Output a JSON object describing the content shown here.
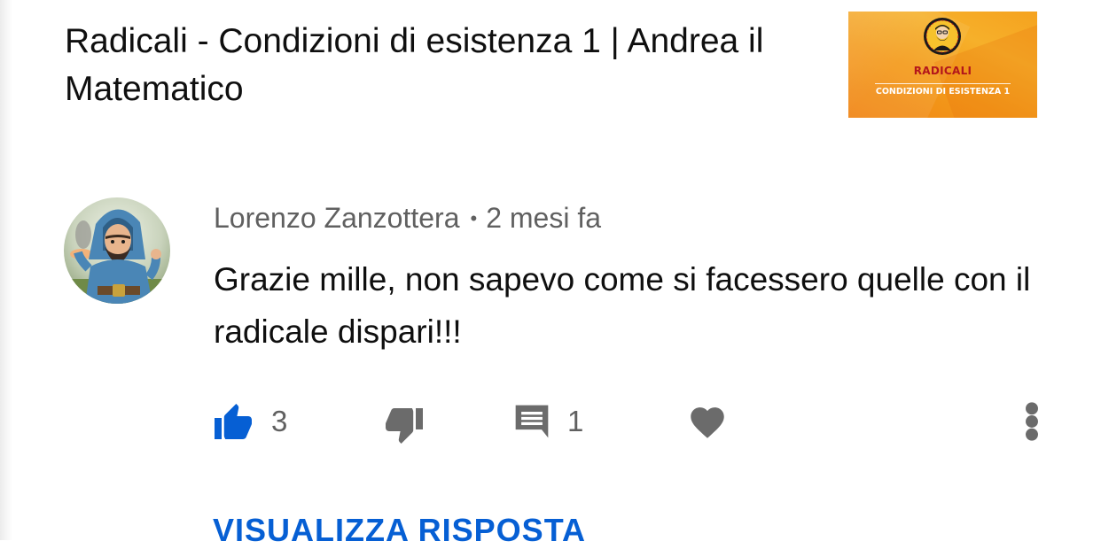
{
  "video": {
    "title": "Radicali - Condizioni di esistenza 1 | Andrea il Matematico",
    "thumbnail": {
      "title": "RADICALI",
      "subtitle": "CONDIZIONI DI ESISTENZA 1",
      "background_color": "#f39a1a",
      "title_color": "#b3161b"
    }
  },
  "comment": {
    "author": "Lorenzo Zanzottera",
    "separator": "•",
    "time": "2 mesi fa",
    "text": "Grazie mille, non sapevo come si facessero quelle con il radicale dispari!!!",
    "avatar_icon": "wizard-avatar",
    "actions": {
      "like_icon": "thumbs-up-icon",
      "like_count": "3",
      "dislike_icon": "thumbs-down-icon",
      "reply_icon": "comment-icon",
      "reply_count": "1",
      "heart_icon": "heart-icon",
      "more_icon": "more-vert-icon"
    },
    "view_replies_label": "VISUALIZZA RISPOSTA"
  },
  "colors": {
    "like_active": "#065fd4",
    "icon_gray": "#6b6b6b",
    "meta_gray": "#606060",
    "link_blue": "#065fd4"
  }
}
